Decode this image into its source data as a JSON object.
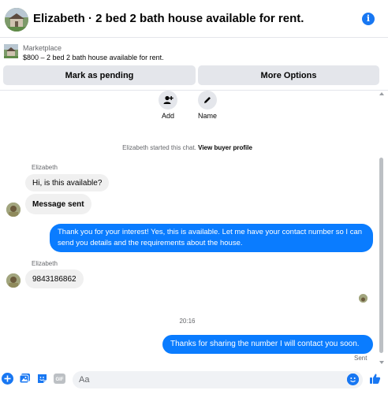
{
  "header": {
    "title": "Elizabeth · 2 bed 2 bath house available for rent.",
    "info_icon": "info-icon"
  },
  "listing": {
    "label": "Marketplace",
    "title": "$800 – 2 bed 2 bath house available for rent.",
    "pending_button": "Mark as pending",
    "more_button": "More Options"
  },
  "actions": {
    "add_label": "Add",
    "name_label": "Name"
  },
  "system": {
    "started_text": "Elizabeth started this chat.",
    "profile_link": "View buyer profile"
  },
  "messages": {
    "sender_1": "Elizabeth",
    "in_1": "Hi, is this available?",
    "in_2": "Message sent",
    "out_1": "Thank you for your interest! Yes, this is available. Let me have your contact number so I can send you details and the requirements about the house.",
    "sender_2": "Elizabeth",
    "in_3": "9843186862",
    "timestamp": "20:16",
    "out_2": "Thanks for sharing the number I will contact you soon.",
    "status": "Sent"
  },
  "composer": {
    "placeholder": "Aa",
    "icons": [
      "plus-icon",
      "photo-icon",
      "sticker-icon",
      "gif-icon",
      "emoji-icon",
      "like-icon"
    ],
    "gif_label": "GIF"
  },
  "colors": {
    "accent": "#1877f2",
    "outgoing_bubble": "#0a7cff",
    "incoming_bubble": "#f0f0f0",
    "button_bg": "#e4e6eb"
  }
}
